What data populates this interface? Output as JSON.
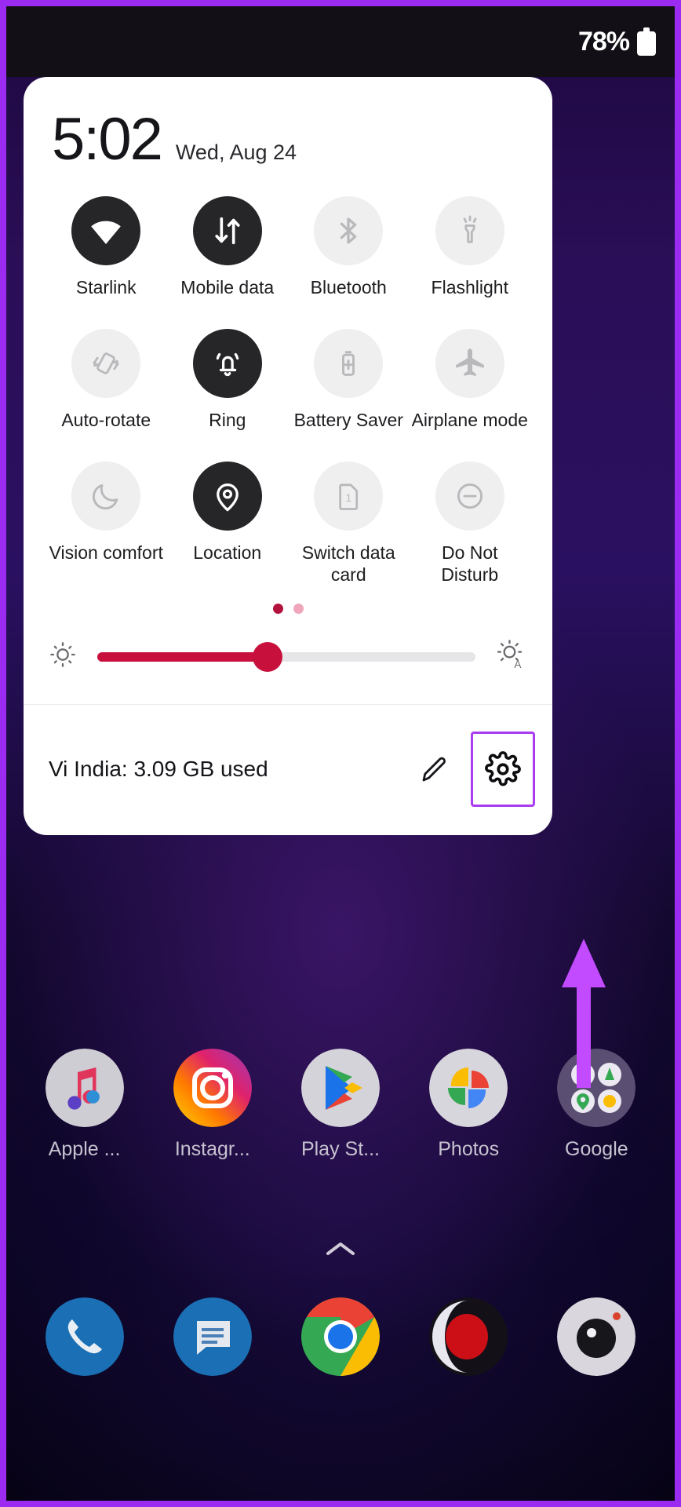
{
  "status_bar": {
    "battery_percent": "78%",
    "battery_icon": "battery-icon"
  },
  "quick_settings": {
    "clock": "5:02",
    "date": "Wed, Aug 24",
    "tiles": [
      {
        "label": "Starlink",
        "icon": "wifi-icon",
        "state": "on"
      },
      {
        "label": "Mobile data",
        "icon": "mobile-data-icon",
        "state": "on"
      },
      {
        "label": "Bluetooth",
        "icon": "bluetooth-icon",
        "state": "off"
      },
      {
        "label": "Flashlight",
        "icon": "flashlight-icon",
        "state": "off"
      },
      {
        "label": "Auto-rotate",
        "icon": "auto-rotate-icon",
        "state": "off"
      },
      {
        "label": "Ring",
        "icon": "bell-icon",
        "state": "on"
      },
      {
        "label": "Battery Saver",
        "icon": "battery-saver-icon",
        "state": "off"
      },
      {
        "label": "Airplane mode",
        "icon": "airplane-icon",
        "state": "off"
      },
      {
        "label": "Vision comfort",
        "icon": "moon-icon",
        "state": "off"
      },
      {
        "label": "Location",
        "icon": "location-pin-icon",
        "state": "on"
      },
      {
        "label": "Switch data card",
        "icon": "sim-card-icon",
        "state": "off"
      },
      {
        "label": "Do Not Disturb",
        "icon": "do-not-disturb-icon",
        "state": "off"
      }
    ],
    "page_dots": {
      "count": 2,
      "active_index": 0,
      "active_color": "#b4123d",
      "idle_color": "#f0a6ba"
    },
    "brightness": {
      "value_percent": 45,
      "low_icon": "brightness-low-icon",
      "auto_icon": "brightness-auto-icon",
      "fill_color": "#c8103c"
    },
    "footer": {
      "data_usage": "Vi India: 3.09 GB used",
      "edit_icon": "pencil-icon",
      "settings_icon": "gear-icon"
    }
  },
  "annotation": {
    "highlight_color": "#a93bf0",
    "arrow_color": "#c24bff",
    "frame_color": "#9b2bf0",
    "target": "gear-icon"
  },
  "home_screen": {
    "apps": [
      {
        "label": "Apple ...",
        "icon": "apple-music-icon"
      },
      {
        "label": "Instagr...",
        "icon": "instagram-icon"
      },
      {
        "label": "Play St...",
        "icon": "play-store-icon"
      },
      {
        "label": "Photos",
        "icon": "google-photos-icon"
      },
      {
        "label": "Google",
        "icon": "google-folder-icon"
      }
    ],
    "drawer_chevron": "chevron-up-icon",
    "dock": [
      {
        "icon": "phone-icon"
      },
      {
        "icon": "messages-icon"
      },
      {
        "icon": "chrome-icon"
      },
      {
        "icon": "opera-icon"
      },
      {
        "icon": "camera-icon"
      }
    ]
  }
}
